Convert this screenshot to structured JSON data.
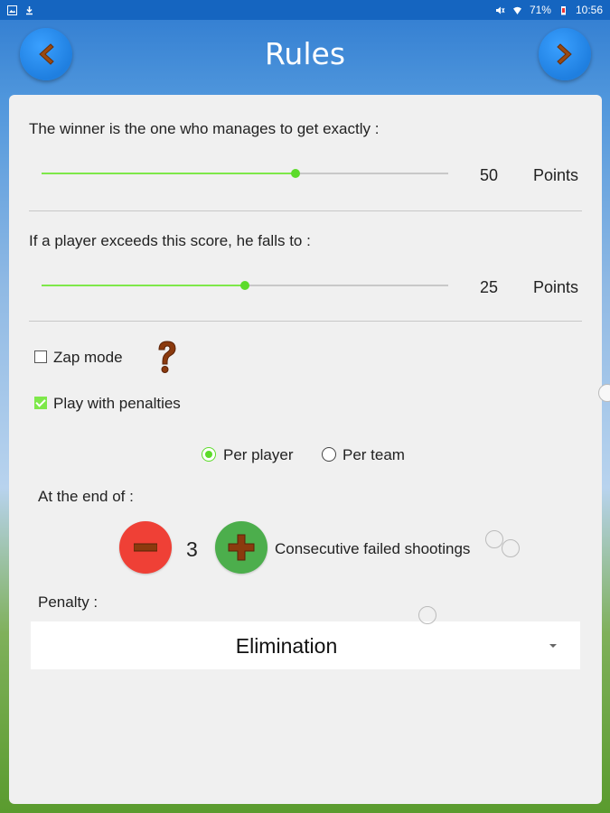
{
  "status_bar": {
    "battery": "71%",
    "time": "10:56"
  },
  "header": {
    "title": "Rules",
    "back_icon": "chevron-left-icon",
    "next_icon": "chevron-right-icon"
  },
  "winner": {
    "label": "The winner is the one who manages to get exactly :",
    "value": "50",
    "unit": "Points",
    "slider_fraction": 0.625
  },
  "exceed": {
    "label": "If a player exceeds this score, he falls to :",
    "value": "25",
    "unit": "Points",
    "slider_fraction": 0.5
  },
  "options": {
    "zap_mode": {
      "label": "Zap mode",
      "checked": false
    },
    "help_icon": "question-mark-icon",
    "penalties": {
      "label": "Play with penalties",
      "checked": true
    }
  },
  "penalty_scope": {
    "per_player": {
      "label": "Per player",
      "selected": true
    },
    "per_team": {
      "label": "Per team",
      "selected": false
    }
  },
  "end_of": {
    "label": "At the end of :",
    "count": "3",
    "description": "Consecutive failed shootings"
  },
  "penalty": {
    "label": "Penalty :",
    "selected": "Elimination"
  },
  "colors": {
    "accent": "#5cdb2a",
    "minus": "#ef4036",
    "plus": "#4cae4c",
    "nav": "#1f7fe0"
  }
}
